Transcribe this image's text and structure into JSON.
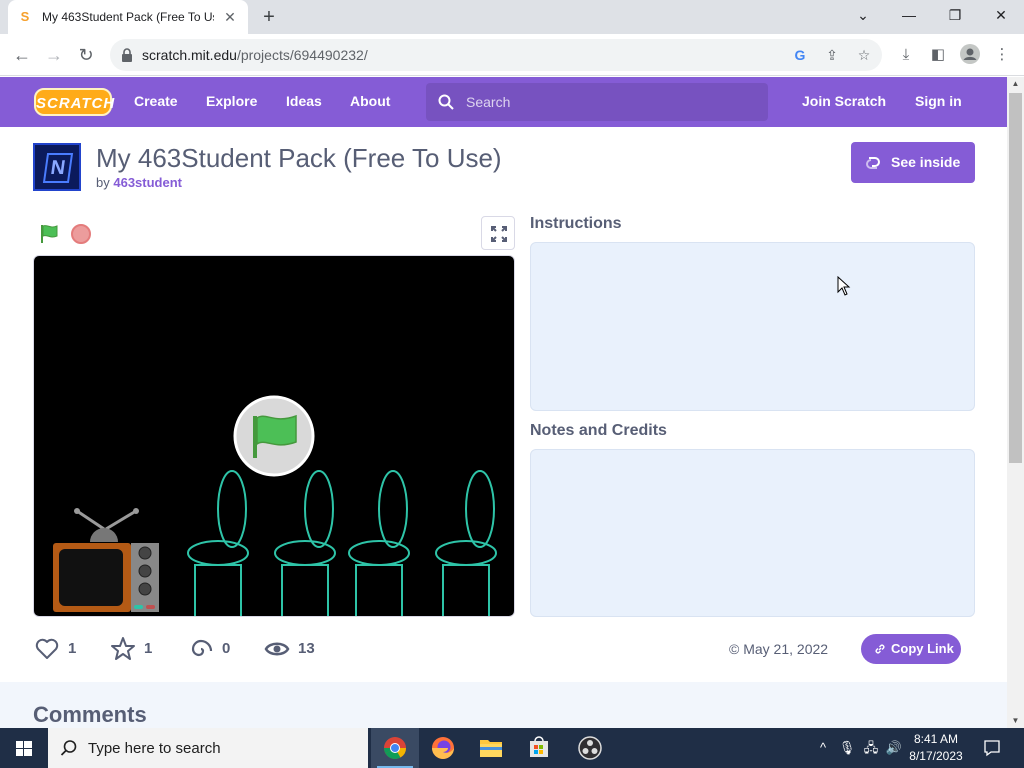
{
  "browser": {
    "tab_title": "My 463Student Pack (Free To Use)",
    "tab_favicon_glyph": "S",
    "url_domain": "scratch.mit.edu",
    "url_path": "/projects/694490232/"
  },
  "nav": {
    "logo_text": "SCRATCH",
    "links": [
      "Create",
      "Explore",
      "Ideas",
      "About"
    ],
    "search_placeholder": "Search",
    "join": "Join Scratch",
    "signin": "Sign in"
  },
  "project": {
    "title": "My 463Student Pack (Free To Use)",
    "by_label": "by",
    "author": "463student",
    "see_inside": "See inside",
    "instructions_heading": "Instructions",
    "notes_heading": "Notes and Credits",
    "instructions_text": "",
    "notes_text": "",
    "stats": {
      "loves": "1",
      "favorites": "1",
      "remixes": "0",
      "views": "13"
    },
    "date": "May 21, 2022",
    "date_prefix": "©",
    "copy_link": "Copy Link",
    "comments_heading": "Comments"
  },
  "taskbar": {
    "search_placeholder": "Type here to search",
    "time": "8:41 AM",
    "date": "8/17/2023"
  },
  "colors": {
    "scratch_purple": "#855cd6",
    "text_gray": "#575e75",
    "panel_blue": "#e9f1fc",
    "flag_green": "#4cbf56",
    "stroke_teal": "#2ec4a8"
  }
}
